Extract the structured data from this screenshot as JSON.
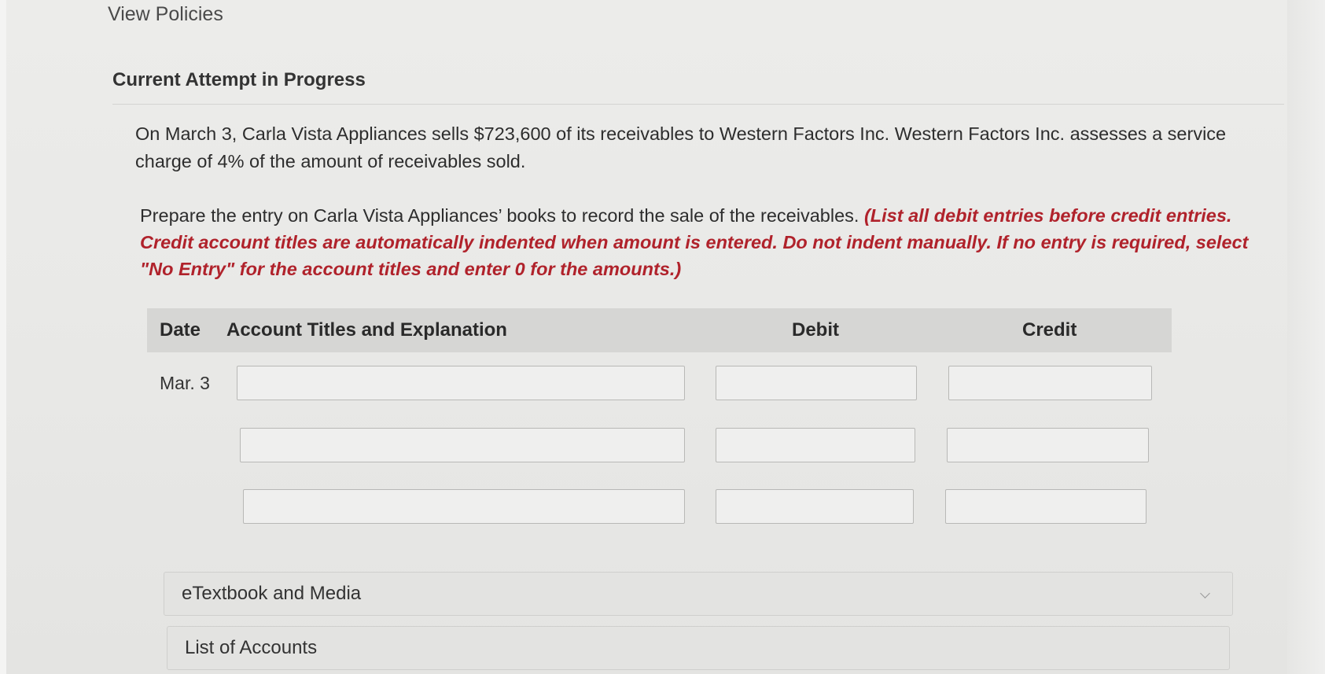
{
  "header": {
    "view_policies": "View Policies",
    "attempt_title": "Current Attempt in Progress"
  },
  "question": {
    "text": "On March 3, Carla Vista Appliances sells $723,600 of its receivables to Western Factors Inc. Western Factors Inc. assesses a service charge of 4% of the amount of receivables sold.",
    "prompt": "Prepare the entry on Carla Vista Appliances’ books to record the sale of the receivables.",
    "note": "(List all debit entries before credit entries. Credit account titles are automatically indented when amount is entered. Do not indent manually. If no entry is required, select \"No Entry\" for the account titles and enter 0 for the amounts.)"
  },
  "table": {
    "headers": {
      "date": "Date",
      "account": "Account Titles and Explanation",
      "debit": "Debit",
      "credit": "Credit"
    },
    "date_label": "Mar. 3",
    "rows": [
      {
        "account": "",
        "debit": "",
        "credit": ""
      },
      {
        "account": "",
        "debit": "",
        "credit": ""
      },
      {
        "account": "",
        "debit": "",
        "credit": ""
      }
    ]
  },
  "accordions": {
    "etextbook": "eTextbook and Media",
    "list_of_accounts": "List of Accounts"
  }
}
